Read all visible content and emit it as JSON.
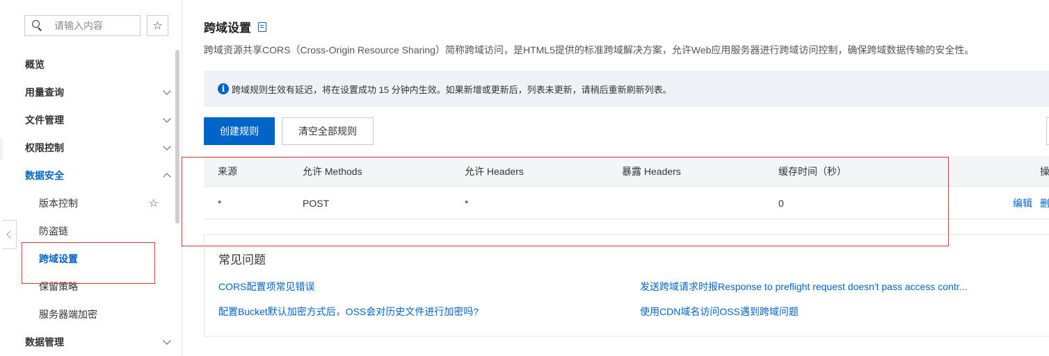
{
  "sidebar": {
    "search_placeholder": "请输入内容",
    "star": "☆",
    "menu": [
      {
        "label": "概览"
      },
      {
        "label": "用量查询"
      },
      {
        "label": "文件管理"
      },
      {
        "label": "权限控制"
      },
      {
        "label": "数据安全"
      }
    ],
    "sub_items": [
      {
        "label": "版本控制"
      },
      {
        "label": "防盗链"
      },
      {
        "label": "跨域设置"
      },
      {
        "label": "保留策略"
      },
      {
        "label": "服务器端加密"
      }
    ],
    "bottom_menu": {
      "label": "数据管理"
    }
  },
  "page": {
    "title": "跨域设置",
    "description": "跨域资源共享CORS（Cross-Origin Resource Sharing）简称跨域访问，是HTML5提供的标准跨域解决方案，允许Web应用服务器进行跨域访问控制，确保跨域数据传输的安全性。",
    "notice": "跨域规则生效有延迟，将在设置成功 15 分钟内生效。如果新增或更新后，列表未更新，请稍后重新刷新列表。",
    "info_glyph": "i"
  },
  "toolbar": {
    "create_label": "创建规则",
    "clear_label": "清空全部规则"
  },
  "table": {
    "headers": [
      "来源",
      "允许 Methods",
      "允许 Headers",
      "暴露 Headers",
      "缓存时间（秒）",
      "操"
    ],
    "rows": [
      {
        "origin": "*",
        "methods": "POST",
        "allow_headers": "*",
        "expose_headers": "",
        "max_age": "0",
        "edit": "编辑",
        "delete": "删"
      }
    ]
  },
  "faq": {
    "title": "常见问题",
    "links": [
      "CORS配置项常见错误",
      "发送跨域请求时报Response to preflight request doesn't pass access contr...",
      "配置Bucket默认加密方式后，OSS会对历史文件进行加密吗?",
      "使用CDN域名访问OSS遇到跨域问题"
    ]
  },
  "colors": {
    "accent": "#0064c8",
    "highlight_box": "#e0302e"
  }
}
